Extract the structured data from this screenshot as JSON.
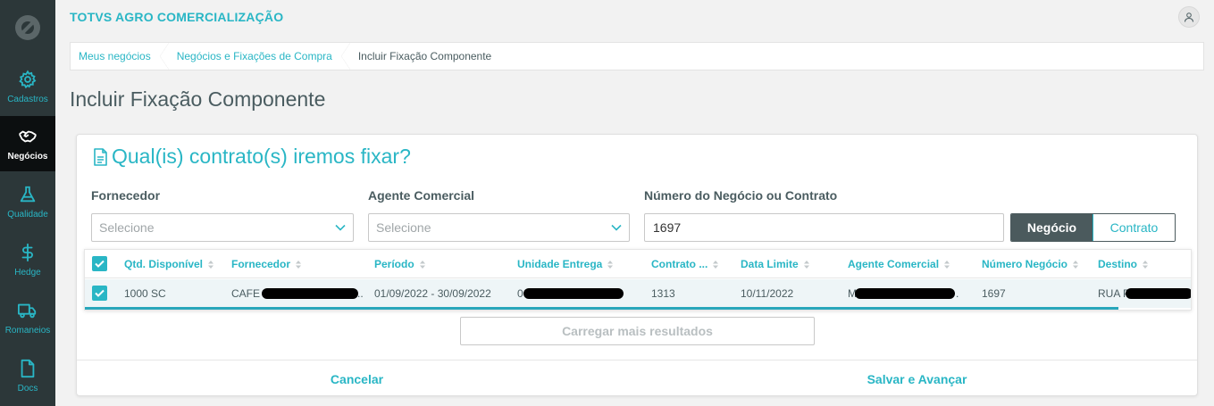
{
  "app": {
    "title": "TOTVS AGRO COMERCIALIZAÇÃO"
  },
  "sidebar": {
    "items": [
      {
        "label": "Cadastros",
        "icon": "gear-icon"
      },
      {
        "label": "Negócios",
        "icon": "handshake-icon",
        "active": true
      },
      {
        "label": "Qualidade",
        "icon": "flask-icon"
      },
      {
        "label": "Hedge",
        "icon": "dollar-icon"
      },
      {
        "label": "Romaneios",
        "icon": "truck-icon"
      },
      {
        "label": "Docs",
        "icon": "document-icon"
      }
    ]
  },
  "breadcrumb": [
    "Meus negócios",
    "Negócios e Fixações de Compra",
    "Incluir Fixação Componente"
  ],
  "page": {
    "title": "Incluir Fixação Componente"
  },
  "card": {
    "title": "Qual(is) contrato(s) iremos fixar?",
    "filters": {
      "fornecedor": {
        "label": "Fornecedor",
        "placeholder": "Selecione"
      },
      "agente": {
        "label": "Agente Comercial",
        "placeholder": "Selecione"
      },
      "numero": {
        "label": "Número do Negócio ou Contrato",
        "value": "1697"
      }
    },
    "toggle": {
      "options": [
        "Negócio",
        "Contrato"
      ],
      "selected": "Negócio"
    },
    "table": {
      "columns": [
        "Qtd. Disponível",
        "Fornecedor",
        "Período",
        "Unidade Entrega",
        "Contrato ...",
        "Data Limite",
        "Agente Comercial",
        "Número Negócio",
        "Destino"
      ],
      "rows": [
        {
          "checked": true,
          "qtd": "1000 SC",
          "fornecedor": "CAFE",
          "fornecedor_suffix": "..",
          "periodo": "01/09/2022 - 30/09/2022",
          "unidade": "0",
          "contrato": "1313",
          "data_limite": "10/11/2022",
          "agente": "M",
          "agente_suffix": ".",
          "numero_negocio": "1697",
          "destino": "RUA P"
        }
      ]
    },
    "load_more": "Carregar mais resultados",
    "cancel": "Cancelar",
    "save": "Salvar e Avançar"
  },
  "colors": {
    "accent": "#29b6c5",
    "sidebar": "#2c3739",
    "sidebar_active": "#0c0f10",
    "toggle_active": "#4b5a5d"
  }
}
